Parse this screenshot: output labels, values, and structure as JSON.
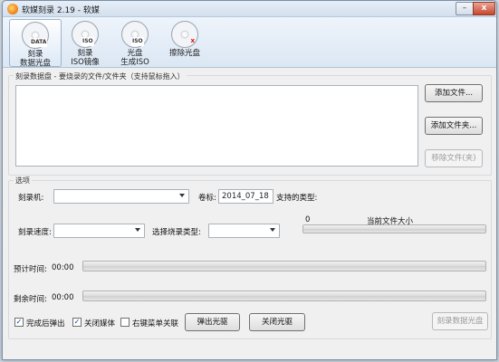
{
  "window": {
    "title": "软媒刻录 2.19 - 软媒",
    "close_glyph": "x"
  },
  "toolbar": {
    "items": [
      {
        "line1": "刻录",
        "line2": "数据光盘",
        "disc_tag": "DATA"
      },
      {
        "line1": "刻录",
        "line2": "ISO镜像",
        "disc_tag": "ISO"
      },
      {
        "line1": "光盘",
        "line2": "生成ISO",
        "disc_tag": "ISO"
      },
      {
        "line1": "擦除光盘",
        "line2": "",
        "disc_tag": "x"
      }
    ]
  },
  "data_group": {
    "title": "刻录数据盘 - 要烧录的文件/文件夹（支持鼠标拖入）",
    "add_file": "添加文件...",
    "add_folder": "添加文件夹...",
    "remove_file": "移除文件(夹)"
  },
  "options": {
    "title": "选项",
    "burner_label": "刻录机:",
    "volume_label": "卷标:",
    "volume_value": "2014_07_18",
    "supported_types_label": "支持的类型:",
    "speed_label": "刻录速度:",
    "burn_type_label": "选择烧录类型:",
    "file_size_value": "0",
    "file_size_label": "当前文件大小",
    "eta_label": "预计时间:",
    "eta_value": "00:00",
    "remaining_label": "剩余时间:",
    "remaining_value": "00:00",
    "eject_after_label": "完成后弹出",
    "close_media_label": "关闭媒体",
    "context_menu_label": "右键菜单关联",
    "eject_disc": "弹出光驱",
    "close_disc": "关闭光驱",
    "burn_data_disc": "刻录数据光盘",
    "checks": {
      "eject_after": true,
      "close_media": true,
      "context_menu": false
    }
  }
}
